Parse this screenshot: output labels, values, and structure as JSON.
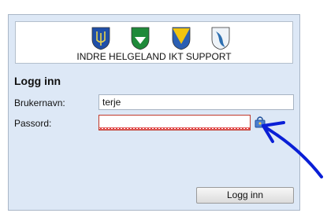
{
  "banner": {
    "org_name": "INDRE HELGELAND IKT SUPPORT",
    "crests": [
      "crest-1-icon",
      "crest-2-icon",
      "crest-3-icon",
      "crest-4-icon"
    ]
  },
  "login": {
    "heading": "Logg inn",
    "username_label": "Brukernavn:",
    "username_value": "terje",
    "password_label": "Passord:",
    "password_value": "",
    "submit_label": "Logg inn"
  },
  "colors": {
    "panel_bg": "#dde8f6",
    "error_border": "#c0392b",
    "annotation_arrow": "#0a1fd6"
  }
}
